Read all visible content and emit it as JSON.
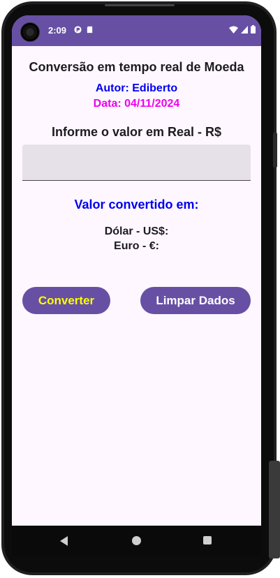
{
  "status_bar": {
    "time": "2:09"
  },
  "app": {
    "title": "Conversão em tempo real de Moeda",
    "author": "Autor: Ediberto",
    "date": "Data: 04/11/2024",
    "prompt": "Informe o valor em Real - R$",
    "input": {
      "value": "",
      "placeholder": ""
    },
    "converted_title": "Valor convertido em:",
    "dolar_label": "Dólar - US$:",
    "euro_label": "Euro - €:",
    "convert_button": "Converter",
    "clear_button": "Limpar Dados"
  },
  "colors": {
    "primary": "#6750a4",
    "author": "#0000ee",
    "date": "#ee00ee",
    "convert_text": "#ffff00",
    "background": "#fef7ff",
    "input_bg": "#e6e0e9"
  },
  "icons": [
    "camera-icon",
    "status-notification-icon",
    "sd-card-icon",
    "wifi-icon",
    "signal-icon",
    "battery-icon",
    "nav-back-icon",
    "nav-home-icon",
    "nav-recents-icon"
  ]
}
